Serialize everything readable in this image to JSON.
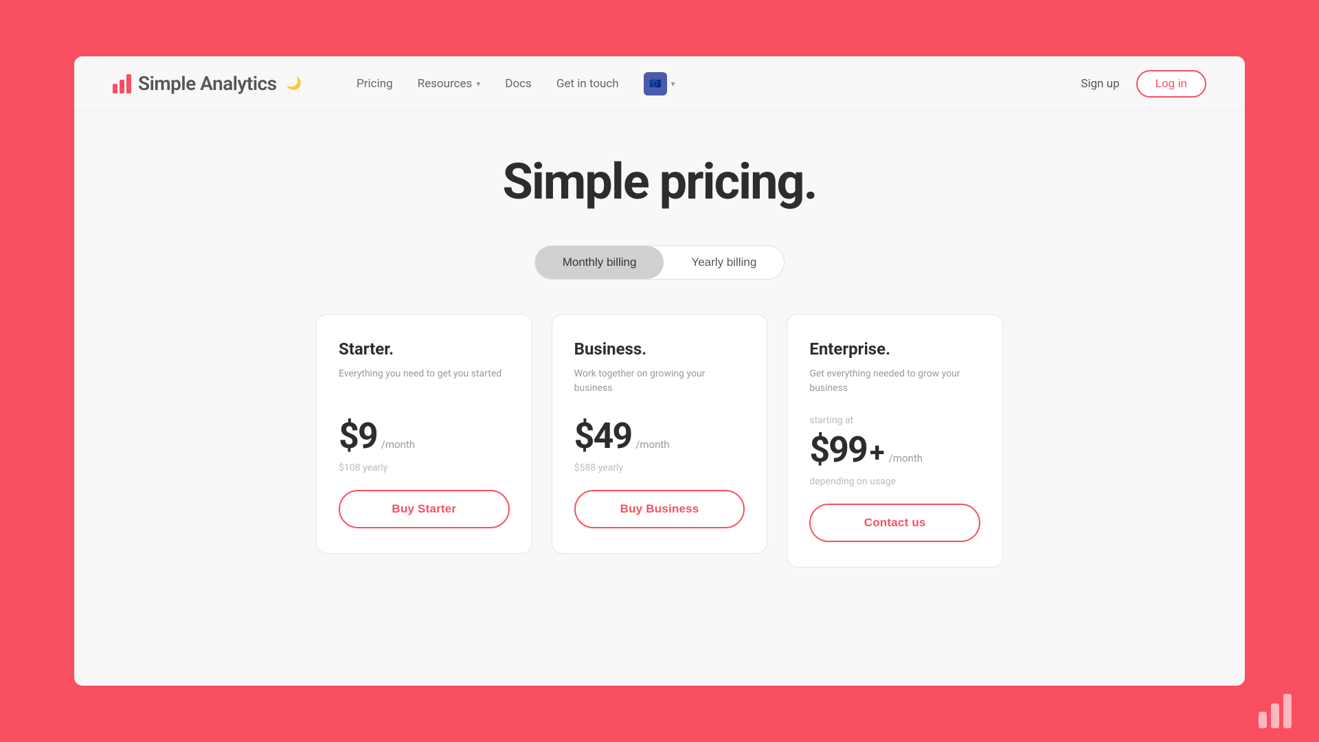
{
  "brand": {
    "name": "Simple Analytics",
    "logo_icon": "bar-chart-icon"
  },
  "nav": {
    "links": [
      {
        "label": "Pricing",
        "has_dropdown": false
      },
      {
        "label": "Resources",
        "has_dropdown": true
      },
      {
        "label": "Docs",
        "has_dropdown": false
      },
      {
        "label": "Get in touch",
        "has_dropdown": false
      }
    ],
    "eu_badge": "🇪🇺",
    "sign_up": "Sign up",
    "login": "Log in"
  },
  "hero": {
    "title": "Simple pricing."
  },
  "billing": {
    "monthly_label": "Monthly billing",
    "yearly_label": "Yearly billing",
    "active": "monthly"
  },
  "plans": [
    {
      "name": "Starter.",
      "description": "Everything you need to get you started",
      "starting_at": "",
      "price": "$9",
      "price_plus": "",
      "period": "/month",
      "yearly": "$108 yearly",
      "depending_on": "",
      "button_label": "Buy Starter"
    },
    {
      "name": "Business.",
      "description": "Work together on growing your business",
      "starting_at": "",
      "price": "$49",
      "price_plus": "",
      "period": "/month",
      "yearly": "$588 yearly",
      "depending_on": "",
      "button_label": "Buy Business"
    },
    {
      "name": "Enterprise.",
      "description": "Get everything needed to grow your business",
      "starting_at": "starting at",
      "price": "$99",
      "price_plus": "+",
      "period": "/month",
      "yearly": "",
      "depending_on": "depending on usage",
      "button_label": "Contact us"
    }
  ]
}
